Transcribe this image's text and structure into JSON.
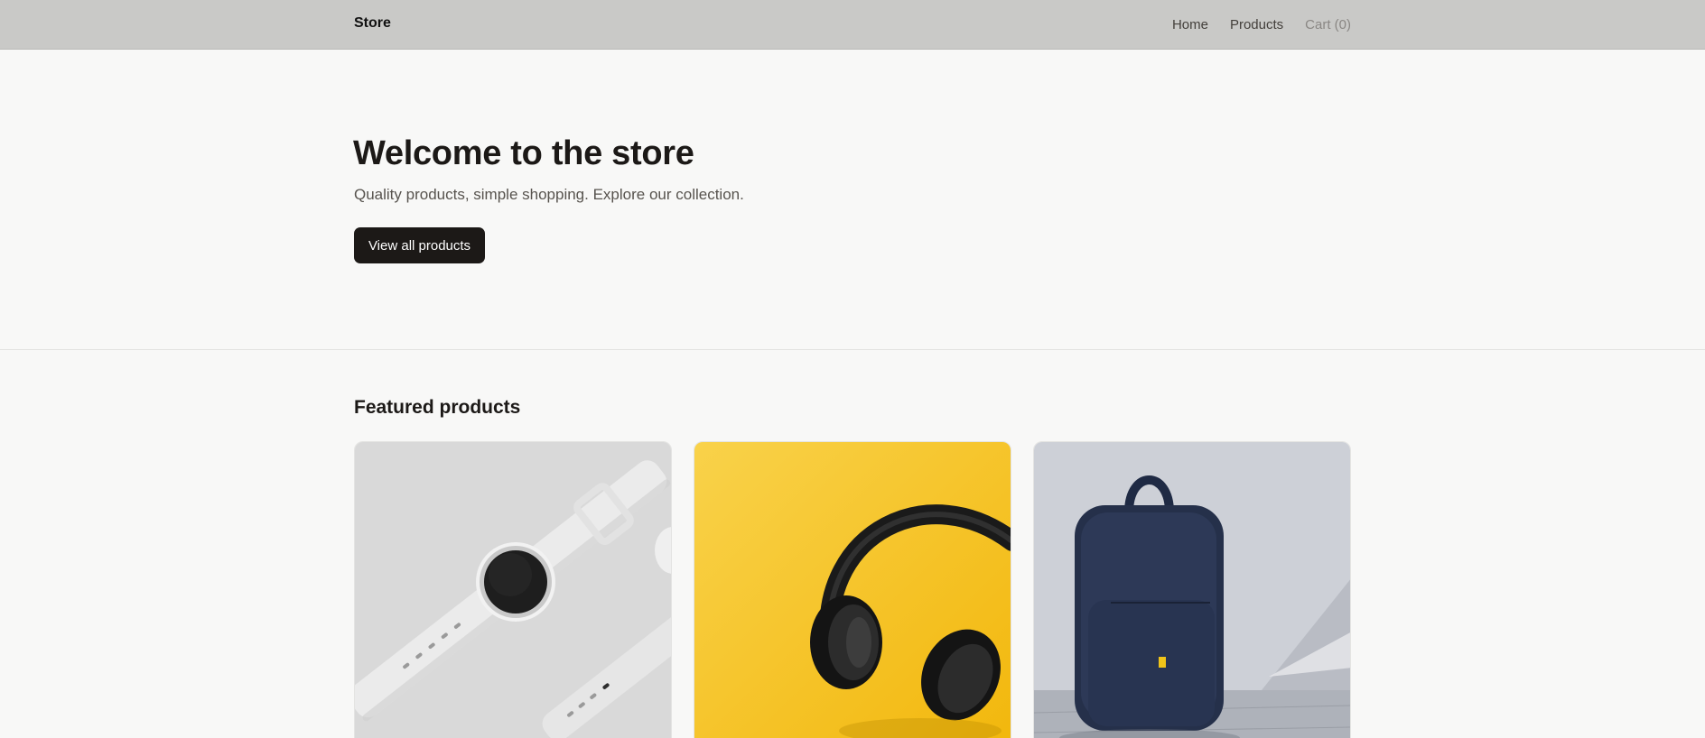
{
  "header": {
    "brand": "Store",
    "nav": [
      {
        "label": "Home"
      },
      {
        "label": "Products"
      },
      {
        "label": "Cart (0)"
      }
    ]
  },
  "hero": {
    "title": "Welcome to the store",
    "subtitle": "Quality products, simple shopping. Explore our collection.",
    "cta_label": "View all products"
  },
  "featured": {
    "title": "Featured products",
    "products": [
      {
        "image": "smartwatch-photo",
        "bg": "#dcdcdc"
      },
      {
        "image": "headphones-photo",
        "bg": "#f7c524"
      },
      {
        "image": "backpack-photo",
        "bg": "#c8ccd4"
      }
    ]
  }
}
